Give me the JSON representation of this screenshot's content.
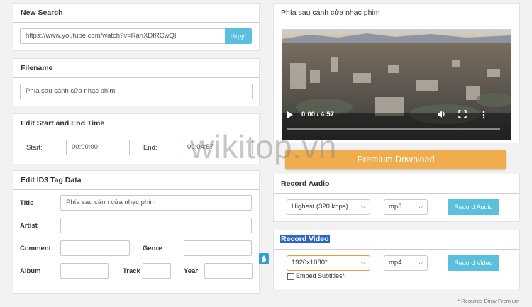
{
  "new_search": {
    "title": "New Search",
    "url_value": "https://www.youtube.com/watch?v=RanXDfRCwQI",
    "submit_label": "dirpy!"
  },
  "filename": {
    "title": "Filename",
    "value": "Phía sau cánh cửa nhạc phim"
  },
  "edit_time": {
    "title": "Edit Start and End Time",
    "start_label": "Start:",
    "start_value": "00:00:00",
    "end_label": "End:",
    "end_value": "00:04:57"
  },
  "id3": {
    "title": "Edit ID3 Tag Data",
    "title_label": "Title",
    "title_value": "Phía sau cánh cửa nhạc phim",
    "artist_label": "Artist",
    "comment_label": "Comment",
    "genre_label": "Genre",
    "album_label": "Album",
    "track_label": "Track",
    "year_label": "Year"
  },
  "video": {
    "title": "Phía sau cánh cửa nhạc phim",
    "time_display": "0:00 / 4:57"
  },
  "watermark": "wikitop.vn",
  "premium_download_label": "Premium Download",
  "record_audio": {
    "title": "Record Audio",
    "quality": "Highest (320 kbps)",
    "format": "mp3",
    "button_label": "Record Audio"
  },
  "record_video": {
    "title": "Record Video",
    "resolution": "1920x1080*",
    "format": "mp4",
    "button_label": "Record Video",
    "embed_subtitles_label": "Embed Subtitles*"
  },
  "footnote": "* Requires Dirpy Premium",
  "colors": {
    "accent_blue": "#5bc0de",
    "premium_orange": "#f0ad4e"
  }
}
